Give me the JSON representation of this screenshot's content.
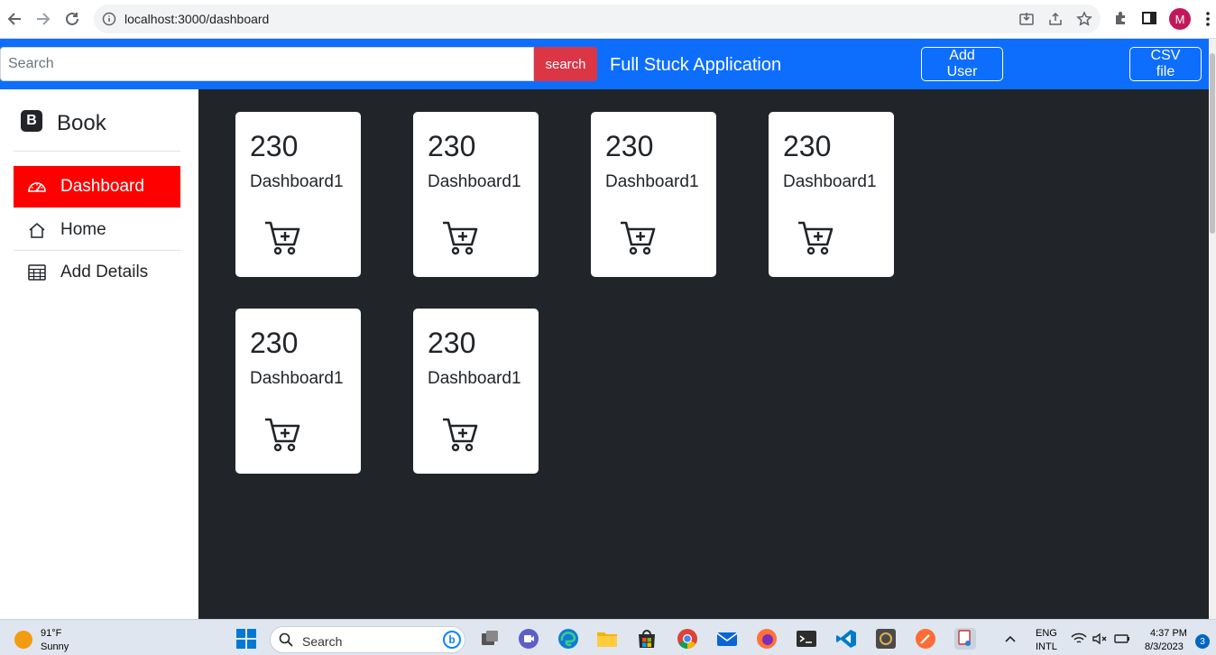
{
  "browser": {
    "url": "localhost:3000/dashboard",
    "profile_initial": "M"
  },
  "topbar": {
    "search_placeholder": "Search",
    "search_button": "search",
    "brand": "Full Stuck Application",
    "add_user": "Add User",
    "csv_file": "CSV file"
  },
  "sidebar": {
    "logo_letter": "B",
    "logo_text": "Book",
    "items": [
      {
        "label": "Dashboard",
        "icon": "speedometer-icon",
        "active": true
      },
      {
        "label": "Home",
        "icon": "house-icon",
        "active": false
      },
      {
        "label": "Add Details",
        "icon": "table-icon",
        "active": false
      }
    ]
  },
  "cards": [
    {
      "value": "230",
      "label": "Dashboard1",
      "icon": "cart-plus-icon"
    },
    {
      "value": "230",
      "label": "Dashboard1",
      "icon": "cart-plus-icon"
    },
    {
      "value": "230",
      "label": "Dashboard1",
      "icon": "cart-plus-icon"
    },
    {
      "value": "230",
      "label": "Dashboard1",
      "icon": "cart-plus-icon"
    },
    {
      "value": "230",
      "label": "Dashboard1",
      "icon": "cart-plus-icon"
    },
    {
      "value": "230",
      "label": "Dashboard1",
      "icon": "cart-plus-icon"
    }
  ],
  "colors": {
    "topbar": "#0d6efd",
    "search_button": "#dc3545",
    "active_nav": "#ff0000",
    "main_bg": "#212529"
  },
  "taskbar": {
    "weather_temp": "91°F",
    "weather_desc": "Sunny",
    "search_text": "Search",
    "bing_letter": "b",
    "lang_top": "ENG",
    "lang_bottom": "INTL",
    "time": "4:37 PM",
    "date": "8/3/2023",
    "notification_count": "3"
  }
}
